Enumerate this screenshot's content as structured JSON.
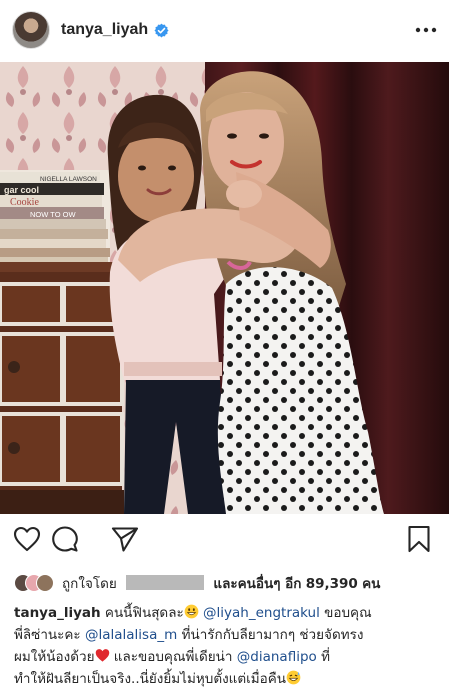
{
  "header": {
    "username": "tanya_liyah"
  },
  "icons": {
    "avatar": "profile-photo",
    "verified": "verified-badge-icon",
    "more": "more-options-icon",
    "like": "heart-outline-icon",
    "comment": "comment-bubble-icon",
    "share": "paper-plane-icon",
    "save": "bookmark-icon"
  },
  "colors": {
    "verified_blue": "#3897f0",
    "mention_blue": "#1f4e8c",
    "text": "#262626"
  },
  "likes": {
    "prefix": "ถูกใจโดย",
    "middle": "และคนอื่นๆ อีก",
    "count": "89,390",
    "suffix": "คน"
  },
  "caption": {
    "username": "tanya_liyah",
    "line1_text": "คนนี้ฟินสุดละ",
    "line1_mention": "@liyah_engtrakul",
    "line1_tail": "ขอบคุณ",
    "line2_text": "พี่ลิซ่านะคะ",
    "line2_mention": "@lalalalisa_m",
    "line2_tail": "ที่น่ารักกับลียามากๆ ช่วยจัดทรง",
    "line3_text": "ผมให้น้องด้วย",
    "line3_mid": "และขอบคุณพี่เดียน่า",
    "line3_mention": "@dianaflipo",
    "line3_tail": "ที่",
    "line4_text": "ทำให้ฝันลียาเป็นจริง..นี่ยังยิ้มไม่หุบตั้งแต่เมื่อคืน"
  },
  "photo": {
    "book_spines": [
      "NIGELLA LAWSON",
      "gar cool",
      "Cookie",
      "NOW TO OW"
    ]
  }
}
